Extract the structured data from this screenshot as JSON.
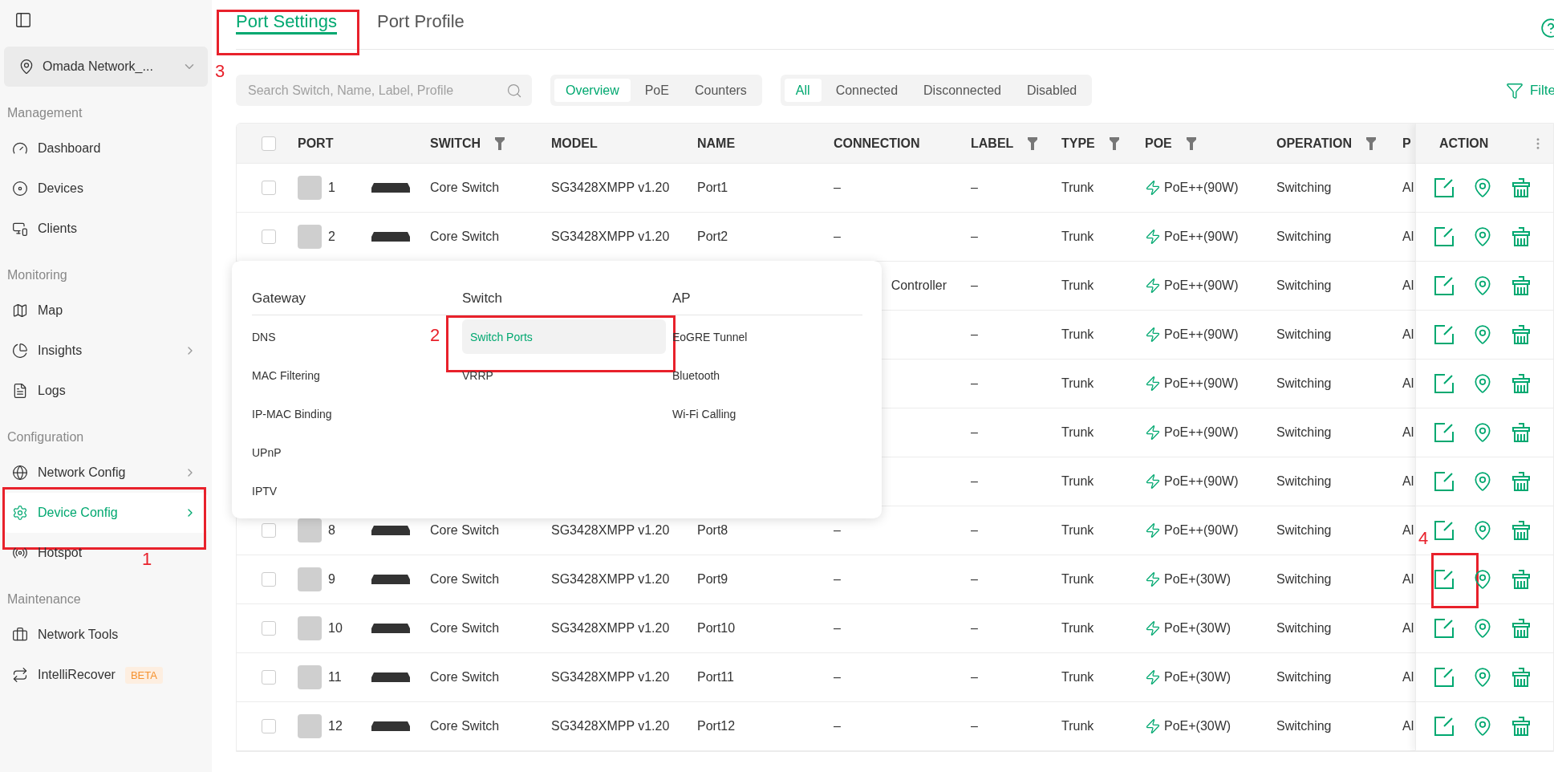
{
  "sidebar": {
    "site": "Omada Network_...",
    "sections": [
      {
        "heading": "Management",
        "items": [
          {
            "label": "Dashboard",
            "selected": false,
            "expandable": false
          },
          {
            "label": "Devices",
            "selected": false,
            "expandable": false
          },
          {
            "label": "Clients",
            "selected": false,
            "expandable": false
          }
        ]
      },
      {
        "heading": "Monitoring",
        "items": [
          {
            "label": "Map",
            "selected": false,
            "expandable": false
          },
          {
            "label": "Insights",
            "selected": false,
            "expandable": true
          },
          {
            "label": "Logs",
            "selected": false,
            "expandable": false
          }
        ]
      },
      {
        "heading": "Configuration",
        "items": [
          {
            "label": "Network Config",
            "selected": false,
            "expandable": true
          },
          {
            "label": "Device Config",
            "selected": true,
            "expandable": true,
            "callout": "1"
          },
          {
            "label": "Hotspot",
            "selected": false,
            "expandable": false
          }
        ]
      },
      {
        "heading": "Maintenance",
        "items": [
          {
            "label": "Network Tools",
            "selected": false,
            "expandable": false
          },
          {
            "label": "IntelliRecover",
            "selected": false,
            "expandable": false,
            "badge": "BETA"
          }
        ]
      }
    ]
  },
  "tabs": [
    {
      "label": "Port Settings",
      "selected": true,
      "callout": "3"
    },
    {
      "label": "Port Profile",
      "selected": false
    }
  ],
  "search": {
    "placeholder": "Search Switch, Name, Label, Profile"
  },
  "view_tabs": [
    {
      "label": "Overview",
      "selected": true
    },
    {
      "label": "PoE",
      "selected": false
    },
    {
      "label": "Counters",
      "selected": false
    }
  ],
  "status_tabs": [
    {
      "label": "All",
      "selected": true
    },
    {
      "label": "Connected",
      "selected": false
    },
    {
      "label": "Disconnected",
      "selected": false
    },
    {
      "label": "Disabled",
      "selected": false
    }
  ],
  "filter_button": "Filte",
  "table": {
    "select_all_checked": false,
    "columns": [
      {
        "label": "PORT",
        "filter": false
      },
      {
        "label": "SWITCH",
        "filter": true
      },
      {
        "label": "MODEL",
        "filter": false
      },
      {
        "label": "NAME",
        "filter": false
      },
      {
        "label": "CONNECTION",
        "filter": false
      },
      {
        "label": "LABEL",
        "filter": true
      },
      {
        "label": "TYPE",
        "filter": true
      },
      {
        "label": "POE",
        "filter": true
      },
      {
        "label": "OPERATION",
        "filter": true
      },
      {
        "label": "P",
        "filter": false
      }
    ],
    "action_column": "ACTION",
    "rows": [
      {
        "checked": false,
        "port": "1",
        "switch": "Core Switch",
        "model": "SG3428XMPP v1.20",
        "name": "Port1",
        "connection": "–",
        "label": "–",
        "type": "Trunk",
        "poe": "PoE++(90W)",
        "operation": "Switching",
        "column_10": "Al"
      },
      {
        "checked": false,
        "port": "2",
        "switch": "Core Switch",
        "model": "SG3428XMPP v1.20",
        "name": "Port2",
        "connection": "–",
        "label": "–",
        "type": "Trunk",
        "poe": "PoE++(90W)",
        "operation": "Switching",
        "column_10": "Al"
      },
      {
        "connection": "Controller",
        "label": "–",
        "type": "Trunk",
        "poe": "PoE++(90W)",
        "operation": "Switching",
        "column_10": "Al"
      },
      {
        "label": "–",
        "type": "Trunk",
        "poe": "PoE++(90W)",
        "operation": "Switching",
        "column_10": "Al"
      },
      {
        "label": "–",
        "type": "Trunk",
        "poe": "PoE++(90W)",
        "operation": "Switching",
        "column_10": "Al"
      },
      {
        "label": "–",
        "type": "Trunk",
        "poe": "PoE++(90W)",
        "operation": "Switching",
        "column_10": "Al"
      },
      {
        "label": "–",
        "type": "Trunk",
        "poe": "PoE++(90W)",
        "operation": "Switching",
        "column_10": "Al"
      },
      {
        "checked": false,
        "port": "8",
        "switch": "Core Switch",
        "model": "SG3428XMPP v1.20",
        "name": "Port8",
        "connection": "–",
        "label": "–",
        "type": "Trunk",
        "poe": "PoE++(90W)",
        "operation": "Switching",
        "column_10": "Al"
      },
      {
        "checked": false,
        "port": "9",
        "switch": "Core Switch",
        "model": "SG3428XMPP v1.20",
        "name": "Port9",
        "connection": "–",
        "label": "–",
        "type": "Trunk",
        "poe": "PoE+(30W)",
        "operation": "Switching",
        "column_10": "Al",
        "edit_callout": "4"
      },
      {
        "checked": false,
        "port": "10",
        "switch": "Core Switch",
        "model": "SG3428XMPP v1.20",
        "name": "Port10",
        "connection": "–",
        "label": "–",
        "type": "Trunk",
        "poe": "PoE+(30W)",
        "operation": "Switching",
        "column_10": "Al"
      },
      {
        "checked": false,
        "port": "11",
        "switch": "Core Switch",
        "model": "SG3428XMPP v1.20",
        "name": "Port11",
        "connection": "–",
        "label": "–",
        "type": "Trunk",
        "poe": "PoE+(30W)",
        "operation": "Switching",
        "column_10": "Al"
      },
      {
        "checked": false,
        "port": "12",
        "switch": "Core Switch",
        "model": "SG3428XMPP v1.20",
        "name": "Port12",
        "connection": "–",
        "label": "–",
        "type": "Trunk",
        "poe": "PoE+(30W)",
        "operation": "Switching",
        "column_10": "Al"
      }
    ]
  },
  "menu": {
    "columns": [
      {
        "heading": "Gateway",
        "items": [
          {
            "label": "DNS",
            "selected": false
          },
          {
            "label": "MAC Filtering",
            "selected": false
          },
          {
            "label": "IP-MAC Binding",
            "selected": false
          },
          {
            "label": "UPnP",
            "selected": false
          },
          {
            "label": "IPTV",
            "selected": false
          }
        ]
      },
      {
        "heading": "Switch",
        "items": [
          {
            "label": "Switch Ports",
            "selected": true,
            "callout": "2"
          },
          {
            "label": "VRRP",
            "selected": false
          }
        ]
      },
      {
        "heading": "AP",
        "items": [
          {
            "label": "EoGRE Tunnel",
            "selected": false
          },
          {
            "label": "Bluetooth",
            "selected": false
          },
          {
            "label": "Wi-Fi Calling",
            "selected": false
          }
        ]
      }
    ]
  }
}
